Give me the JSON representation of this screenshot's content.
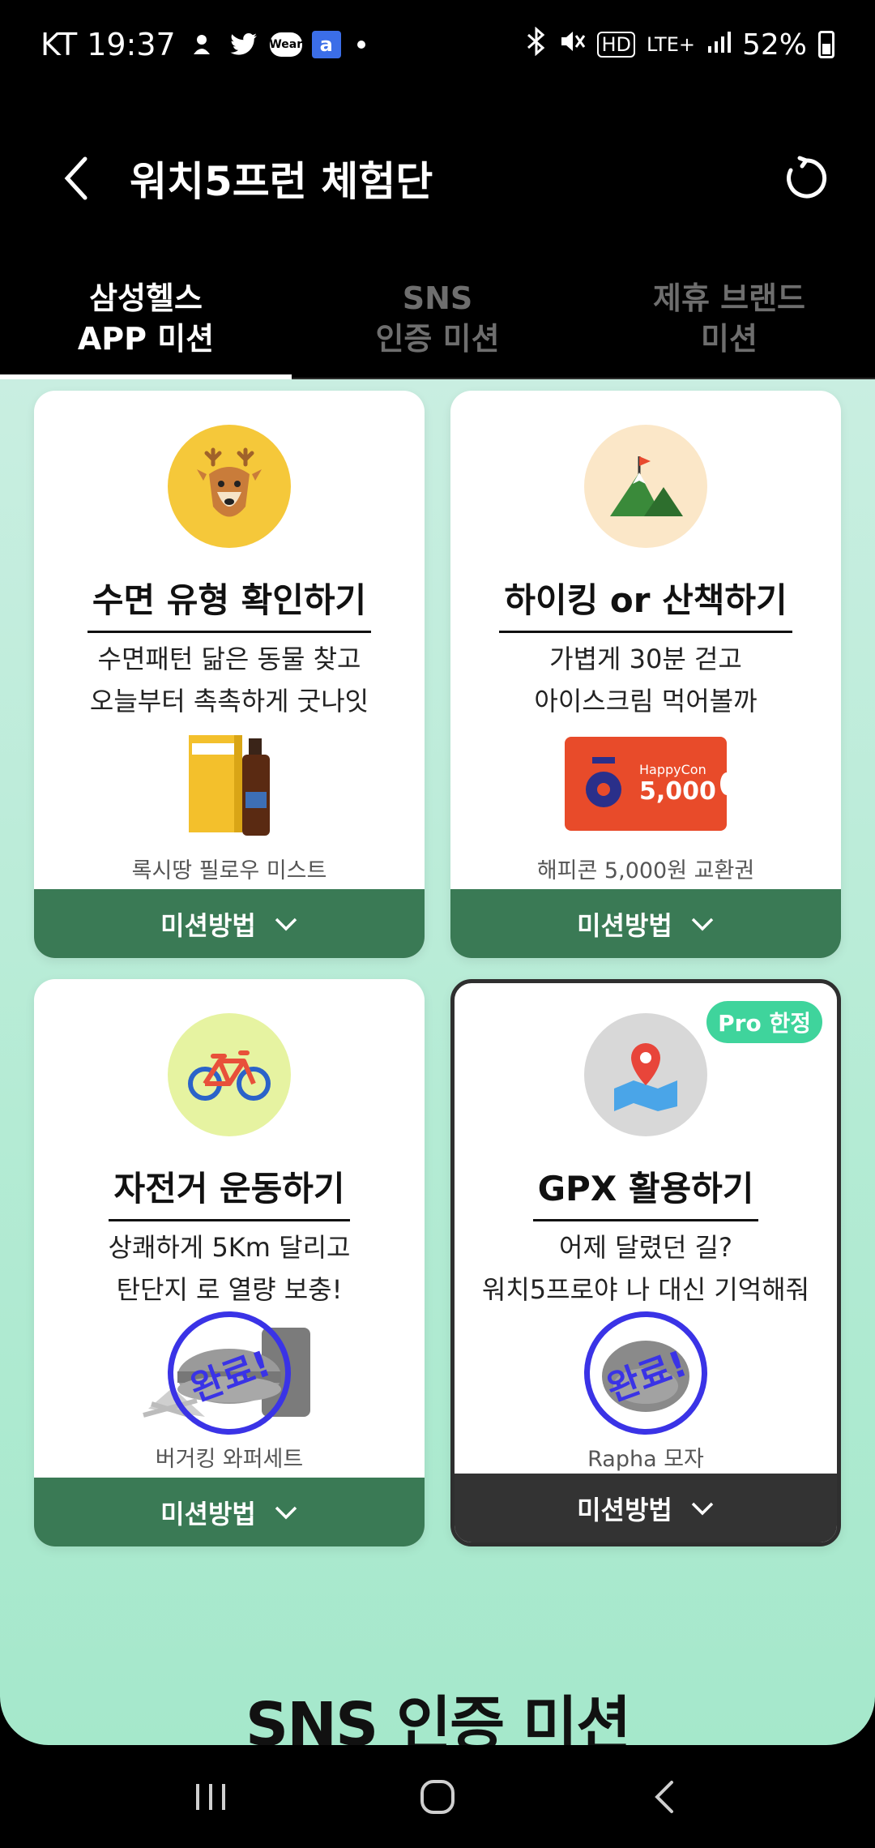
{
  "status_bar": {
    "carrier": "KT",
    "time": "19:37",
    "wear_label": "Wear",
    "a_label": "a",
    "hd": "HD",
    "lte": "LTE+",
    "battery": "52%"
  },
  "app_bar": {
    "title": "워치5프런 체험단"
  },
  "tabs": [
    {
      "line1": "삼성헬스",
      "line2": "APP 미션",
      "active": true
    },
    {
      "line1": "SNS",
      "line2": "인증 미션",
      "active": false
    },
    {
      "line1": "제휴 브랜드",
      "line2": "미션",
      "active": false
    }
  ],
  "cards": [
    {
      "title": "수면 유형 확인하기",
      "desc1": "수면패턴 닮은 동물 찾고",
      "desc2": "오늘부터 촉촉하게 굿나잇",
      "prize_name": "록시땅 필로우 미스트",
      "button": "미션방법",
      "icon": "deer-icon",
      "icon_bg": "#f5c83a"
    },
    {
      "title": "하이킹 or 산책하기",
      "desc1": "가볍게 30분 걷고",
      "desc2": "아이스크림 먹어볼까",
      "prize_name": "해피콘 5,000원 교환권",
      "prize_card": {
        "brand": "HappyCon",
        "amount": "5,000"
      },
      "button": "미션방법",
      "icon": "mountain-icon",
      "icon_bg": "#fbe7c8"
    },
    {
      "title": "자전거 운동하기",
      "desc1": "상쾌하게 5Km 달리고",
      "desc2": "탄단지 로 열량 보충!",
      "prize_name": "버거킹 와퍼세트",
      "stamp": "완료!",
      "button": "미션방법",
      "icon": "bicycle-icon",
      "icon_bg": "#e6f3a1"
    },
    {
      "title": "GPX 활용하기",
      "desc1": "어제 달렸던 길?",
      "desc2": "워치5프로야 나 대신 기억해줘",
      "prize_name": "Rapha 모자",
      "stamp": "완료!",
      "badge": "Pro 한정",
      "button": "미션방법",
      "icon": "map-pin-icon",
      "icon_bg": "#d8d8d8"
    }
  ],
  "section_heading": "SNS 인증 미션",
  "colors": {
    "mission_button": "#3a7a55",
    "stamp": "#3a33e6",
    "pro_badge": "#3fd49c"
  }
}
